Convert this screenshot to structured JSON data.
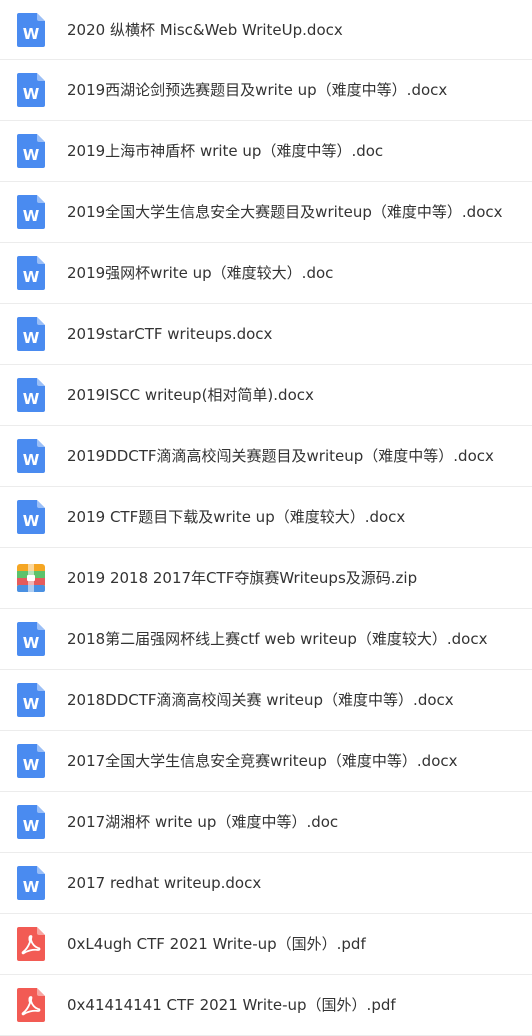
{
  "files": [
    {
      "name": "2020 纵横杯 Misc&Web WriteUp.docx",
      "type": "word"
    },
    {
      "name": "2019西湖论剑预选赛题目及write up（难度中等）.docx",
      "type": "word"
    },
    {
      "name": "2019上海市神盾杯 write up（难度中等）.doc",
      "type": "word"
    },
    {
      "name": "2019全国大学生信息安全大赛题目及writeup（难度中等）.docx",
      "type": "word"
    },
    {
      "name": "2019强网杯write up（难度较大）.doc",
      "type": "word"
    },
    {
      "name": "2019starCTF writeups.docx",
      "type": "word"
    },
    {
      "name": "2019ISCC writeup(相对简单).docx",
      "type": "word"
    },
    {
      "name": "2019DDCTF滴滴高校闯关赛题目及writeup（难度中等）.docx",
      "type": "word"
    },
    {
      "name": "2019 CTF题目下载及write up（难度较大）.docx",
      "type": "word"
    },
    {
      "name": "2019 2018 2017年CTF夺旗赛Writeups及源码.zip",
      "type": "zip"
    },
    {
      "name": "2018第二届强网杯线上赛ctf web writeup（难度较大）.docx",
      "type": "word"
    },
    {
      "name": "2018DDCTF滴滴高校闯关赛 writeup（难度中等）.docx",
      "type": "word"
    },
    {
      "name": "2017全国大学生信息安全竞赛writeup（难度中等）.docx",
      "type": "word"
    },
    {
      "name": "2017湖湘杯 write up（难度中等）.doc",
      "type": "word"
    },
    {
      "name": "2017 redhat writeup.docx",
      "type": "word"
    },
    {
      "name": "0xL4ugh CTF 2021 Write-up（国外）.pdf",
      "type": "pdf"
    },
    {
      "name": "0x41414141 CTF 2021 Write-up（国外）.pdf",
      "type": "pdf"
    }
  ],
  "icons": {
    "word": {
      "label": "W",
      "color": "#4a8bf0"
    },
    "pdf": {
      "color": "#f25b54"
    },
    "zip": {
      "colors": [
        "#f5a623",
        "#5cc26b",
        "#e55b5b",
        "#4a90e2"
      ]
    }
  }
}
